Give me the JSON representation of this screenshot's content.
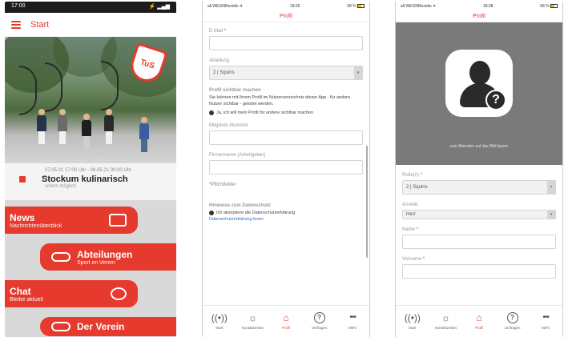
{
  "phone1": {
    "status_time": "17:00",
    "status_right": "⚡ ▂▄▆",
    "topbar_title": "Start",
    "badge_text": "TuS",
    "event": {
      "when": "07.05.21 17:00 Uhr - 08.05.21 00:00 Uhr",
      "title": "Stockum kulinarisch",
      "sub": "sofern möglich"
    },
    "tiles": [
      {
        "title": "News",
        "subtitle": "Nachrichtenüberblick"
      },
      {
        "title": "Abteilungen",
        "subtitle": "Sport im Verein"
      },
      {
        "title": "Chat",
        "subtitle": "Bleibe aktuell"
      },
      {
        "title": "Der Verein",
        "subtitle": ""
      }
    ]
  },
  "phone2": {
    "status_left": "all WEGNResidio ✦",
    "status_time": "18:26",
    "status_right": "68 %",
    "title": "Profil",
    "email_label": "E-Mail",
    "abteilung_label": "Abteilung",
    "abteilung_value": "2 | Squins",
    "visible_heading": "Profil sichtbar machen",
    "visible_text": "Sie können mit Ihrem Profil im Nutzerverzeichnis dieser App - für andere Nutzer sichtbar - gelistet werden.",
    "visible_check": "Ja, ich will mein Profil für andere sichtbar machen",
    "member_label": "Mitglieds-Nummer",
    "company_label": "Firmenname (Arbeitgeber)",
    "pflicht": "Pflichtfelder",
    "privacy_heading": "Hinweise zum Datenschutz",
    "privacy_check": "Ich akzeptiere die Datenschutzerklärung",
    "privacy_link": "Datenschutzerklärung lesen"
  },
  "phone3": {
    "status_left": "all WEGNResidio ✦",
    "status_time": "18:28",
    "status_right": "68 %",
    "title": "Profil",
    "avatar_caption": "zum Abenden auf das Bild tippen",
    "rolle_label": "Rolle(n)",
    "rolle_value": "2 | Squins",
    "anrede_label": "Anrede",
    "anrede_value": "Herr",
    "name_label": "Name",
    "vorname_label": "Vorname"
  },
  "tabbar": [
    {
      "label": "Start",
      "icon": "signal-icon"
    },
    {
      "label": "Kontaktzeiten",
      "icon": "bulb-icon"
    },
    {
      "label": "Profil",
      "icon": "profile-icon"
    },
    {
      "label": "Umfragen",
      "icon": "question-icon"
    },
    {
      "label": "Mehr",
      "icon": "more-icon"
    }
  ]
}
